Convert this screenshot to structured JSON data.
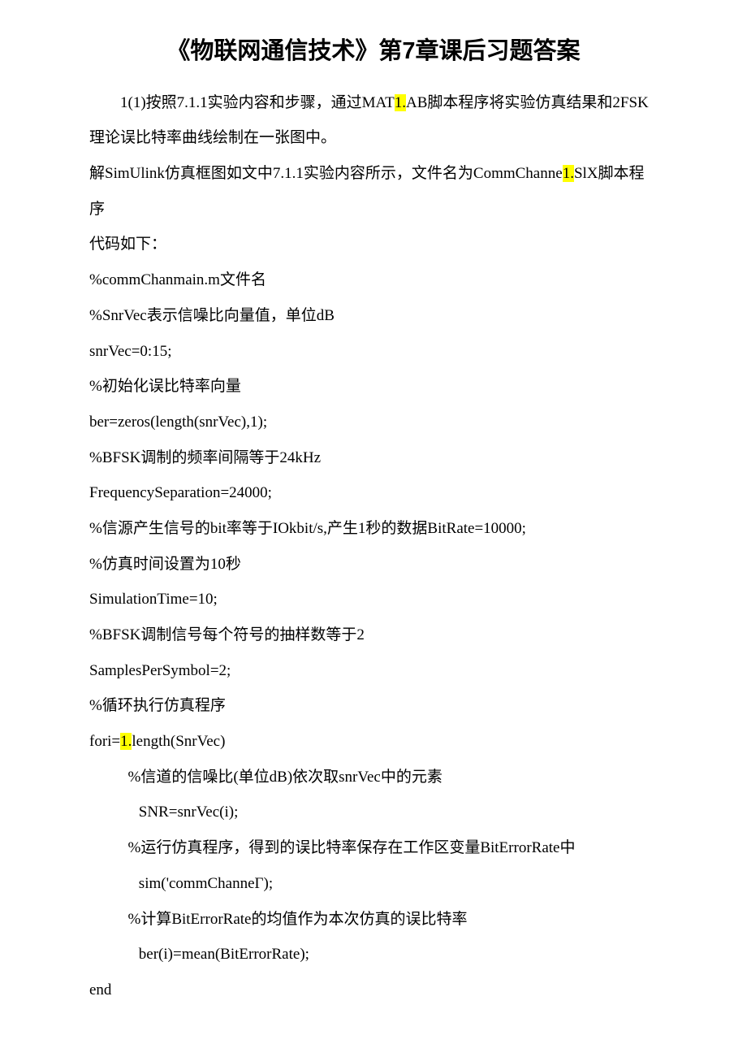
{
  "title": "《物联网通信技术》第7章课后习题答案",
  "lines": {
    "l1a": "1(1)按照7.1.1实验内容和步骤，通过MAT",
    "l1hl": "1.",
    "l1b": "AB脚本程序将实验仿真结果和2FSK",
    "l2": "理论误比特率曲线绘制在一张图中。",
    "l3a": "解SimUlink仿真框图如文中7.1.1实验内容所示，文件名为CommChanne",
    "l3hl": "1.",
    "l3b": "SlX脚本程序",
    "l4": "代码如下：",
    "l5": "%commChanmain.m文件名",
    "l6": "%SnrVec表示信噪比向量值，单位dB",
    "l7": "snrVec=0:15;",
    "l8": "%初始化误比特率向量",
    "l9": "ber=zeros(length(snrVec),1);",
    "l10": "%BFSK调制的频率间隔等于24kHz",
    "l11": "FrequencySeparation=24000;",
    "l12": "%信源产生信号的bit率等于IOkbit/s,产生1秒的数据BitRate=10000;",
    "l13": "%仿真时间设置为10秒",
    "l14": "SimulationTime=10;",
    "l15": "%BFSK调制信号每个符号的抽样数等于2",
    "l16": "SamplesPerSymbol=2;",
    "l17": "%循环执行仿真程序",
    "l18a": "fori=",
    "l18hl": "1.",
    "l18b": "length(SnrVec)",
    "l19": "%信道的信噪比(单位dB)依次取snrVec中的元素",
    "l20": "SNR=snrVec(i);",
    "l21": "%运行仿真程序，得到的误比特率保存在工作区变量BitErrorRate中",
    "l22": "sim('commChanneΓ);",
    "l23": "%计算BitErrorRate的均值作为本次仿真的误比特率",
    "l24": "ber(i)=mean(BitErrorRate);",
    "l25": "end"
  }
}
